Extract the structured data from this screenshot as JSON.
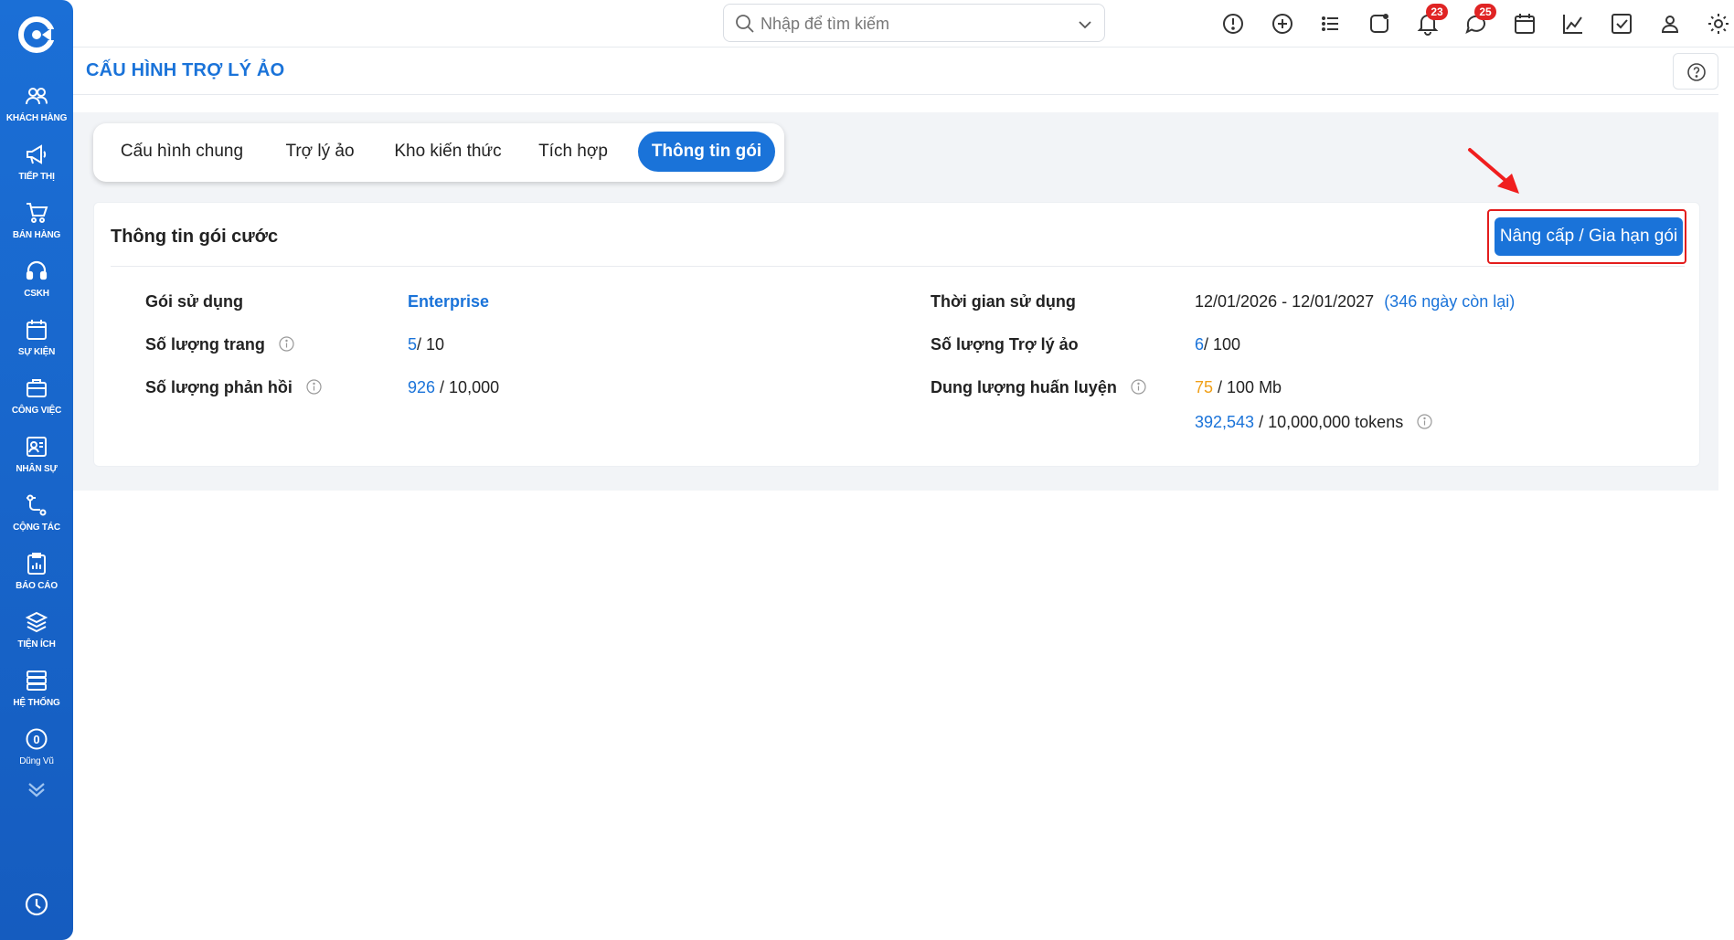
{
  "sidebar": {
    "items": [
      {
        "label": "KHÁCH HÀNG",
        "icon": "users-icon"
      },
      {
        "label": "TIẾP THỊ",
        "icon": "megaphone-icon"
      },
      {
        "label": "BÁN HÀNG",
        "icon": "cart-icon"
      },
      {
        "label": "CSKH",
        "icon": "headset-icon"
      },
      {
        "label": "SỰ KIỆN",
        "icon": "calendar-icon"
      },
      {
        "label": "CÔNG VIỆC",
        "icon": "briefcase-icon"
      },
      {
        "label": "NHÂN SỰ",
        "icon": "id-card-icon"
      },
      {
        "label": "CỘNG TÁC",
        "icon": "connect-icon"
      },
      {
        "label": "BÁO CÁO",
        "icon": "report-icon"
      },
      {
        "label": "TIỆN ÍCH",
        "icon": "layers-icon"
      },
      {
        "label": "HỆ THỐNG",
        "icon": "server-icon"
      },
      {
        "label": "Dũng Vũ",
        "icon": "user-avatar-icon",
        "avatar_text": "0"
      }
    ]
  },
  "topbar": {
    "search_placeholder": "Nhập để tìm kiếm",
    "notifications_count": "23",
    "messages_count": "25"
  },
  "page": {
    "title": "CẤU HÌNH TRỢ LÝ ẢO"
  },
  "tabs": [
    {
      "label": "Cấu hình chung",
      "active": false
    },
    {
      "label": "Trợ lý ảo",
      "active": false
    },
    {
      "label": "Kho kiến thức",
      "active": false
    },
    {
      "label": "Tích hợp",
      "active": false
    },
    {
      "label": "Thông tin gói",
      "active": true
    }
  ],
  "card": {
    "title": "Thông tin gói cước",
    "upgrade_label": "Nâng cấp / Gia hạn gói",
    "left": {
      "plan_label": "Gói sử dụng",
      "plan_value": "Enterprise",
      "pages_label": "Số lượng trang",
      "pages_used": "5",
      "pages_total": "/ 10",
      "replies_label": "Số lượng phản hồi",
      "replies_used": "926",
      "replies_total": " / 10,000"
    },
    "right": {
      "period_label": "Thời gian sử dụng",
      "period_value": "12/01/2026 - 12/01/2027",
      "period_remaining": "(346 ngày còn lại)",
      "assistants_label": "Số lượng Trợ lý ảo",
      "assistants_used": "6",
      "assistants_total": "/ 100",
      "training_label": "Dung lượng huấn luyện",
      "training_used": "75",
      "training_total": " / 100 Mb",
      "tokens_used": "392,543",
      "tokens_total": " / 10,000,000 tokens"
    }
  },
  "colors": {
    "primary": "#1a73d9",
    "sidebar": "#1b6fd6",
    "badge": "#e02424",
    "highlight_frame": "#e31d1d",
    "warning_value": "#f0a019"
  }
}
